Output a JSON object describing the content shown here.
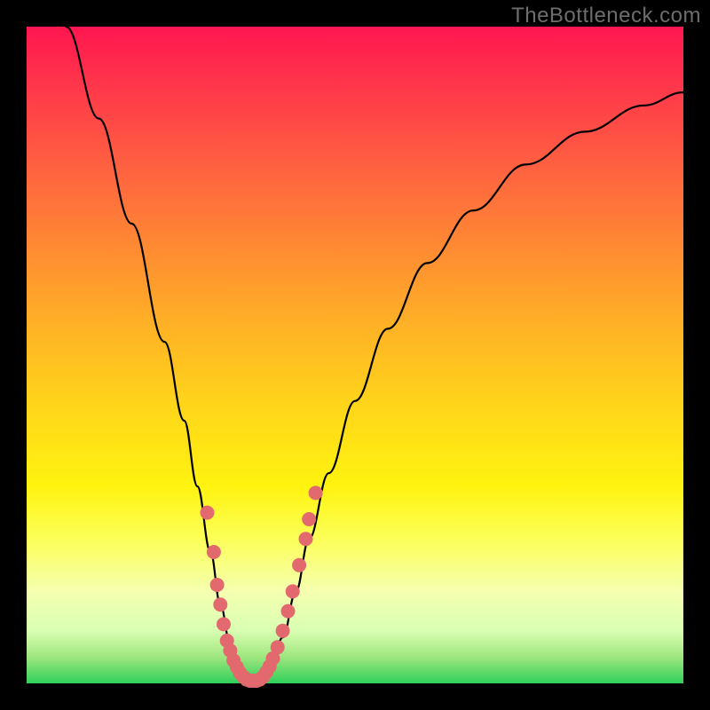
{
  "watermark": "TheBottleneck.com",
  "chart_data": {
    "type": "line",
    "title": "",
    "xlabel": "",
    "ylabel": "",
    "xlim": [
      0,
      100
    ],
    "ylim": [
      0,
      100
    ],
    "grid": false,
    "legend": false,
    "series": [
      {
        "name": "curve",
        "points": [
          {
            "x": 6,
            "y": 100
          },
          {
            "x": 11,
            "y": 86
          },
          {
            "x": 16,
            "y": 70
          },
          {
            "x": 21,
            "y": 52
          },
          {
            "x": 24,
            "y": 40
          },
          {
            "x": 26,
            "y": 30
          },
          {
            "x": 28,
            "y": 20
          },
          {
            "x": 29.5,
            "y": 12
          },
          {
            "x": 31,
            "y": 6
          },
          {
            "x": 32.5,
            "y": 2
          },
          {
            "x": 34,
            "y": 0.5
          },
          {
            "x": 35.5,
            "y": 0.5
          },
          {
            "x": 37,
            "y": 2
          },
          {
            "x": 39,
            "y": 7
          },
          {
            "x": 41,
            "y": 14
          },
          {
            "x": 43,
            "y": 22
          },
          {
            "x": 46,
            "y": 32
          },
          {
            "x": 50,
            "y": 43
          },
          {
            "x": 55,
            "y": 54
          },
          {
            "x": 61,
            "y": 64
          },
          {
            "x": 68,
            "y": 72
          },
          {
            "x": 76,
            "y": 79
          },
          {
            "x": 85,
            "y": 84
          },
          {
            "x": 94,
            "y": 88
          },
          {
            "x": 100,
            "y": 90
          }
        ]
      }
    ],
    "scatter": {
      "name": "data-dots",
      "points": [
        {
          "x": 27.5,
          "y": 26
        },
        {
          "x": 28.5,
          "y": 20
        },
        {
          "x": 29,
          "y": 15
        },
        {
          "x": 29.5,
          "y": 12
        },
        {
          "x": 30,
          "y": 9
        },
        {
          "x": 30.5,
          "y": 6.5
        },
        {
          "x": 31,
          "y": 5
        },
        {
          "x": 31.5,
          "y": 3.5
        },
        {
          "x": 32,
          "y": 2.5
        },
        {
          "x": 32.5,
          "y": 1.6
        },
        {
          "x": 33,
          "y": 1
        },
        {
          "x": 33.5,
          "y": 0.6
        },
        {
          "x": 34,
          "y": 0.4
        },
        {
          "x": 34.5,
          "y": 0.4
        },
        {
          "x": 35,
          "y": 0.4
        },
        {
          "x": 35.5,
          "y": 0.6
        },
        {
          "x": 36,
          "y": 1
        },
        {
          "x": 36.5,
          "y": 1.7
        },
        {
          "x": 37,
          "y": 2.6
        },
        {
          "x": 37.5,
          "y": 3.8
        },
        {
          "x": 38.2,
          "y": 5.5
        },
        {
          "x": 39,
          "y": 8
        },
        {
          "x": 39.8,
          "y": 11
        },
        {
          "x": 40.5,
          "y": 14
        },
        {
          "x": 41.5,
          "y": 18
        },
        {
          "x": 42.5,
          "y": 22
        },
        {
          "x": 43,
          "y": 25
        },
        {
          "x": 44,
          "y": 29
        }
      ]
    },
    "dot_radius_px": 8
  }
}
